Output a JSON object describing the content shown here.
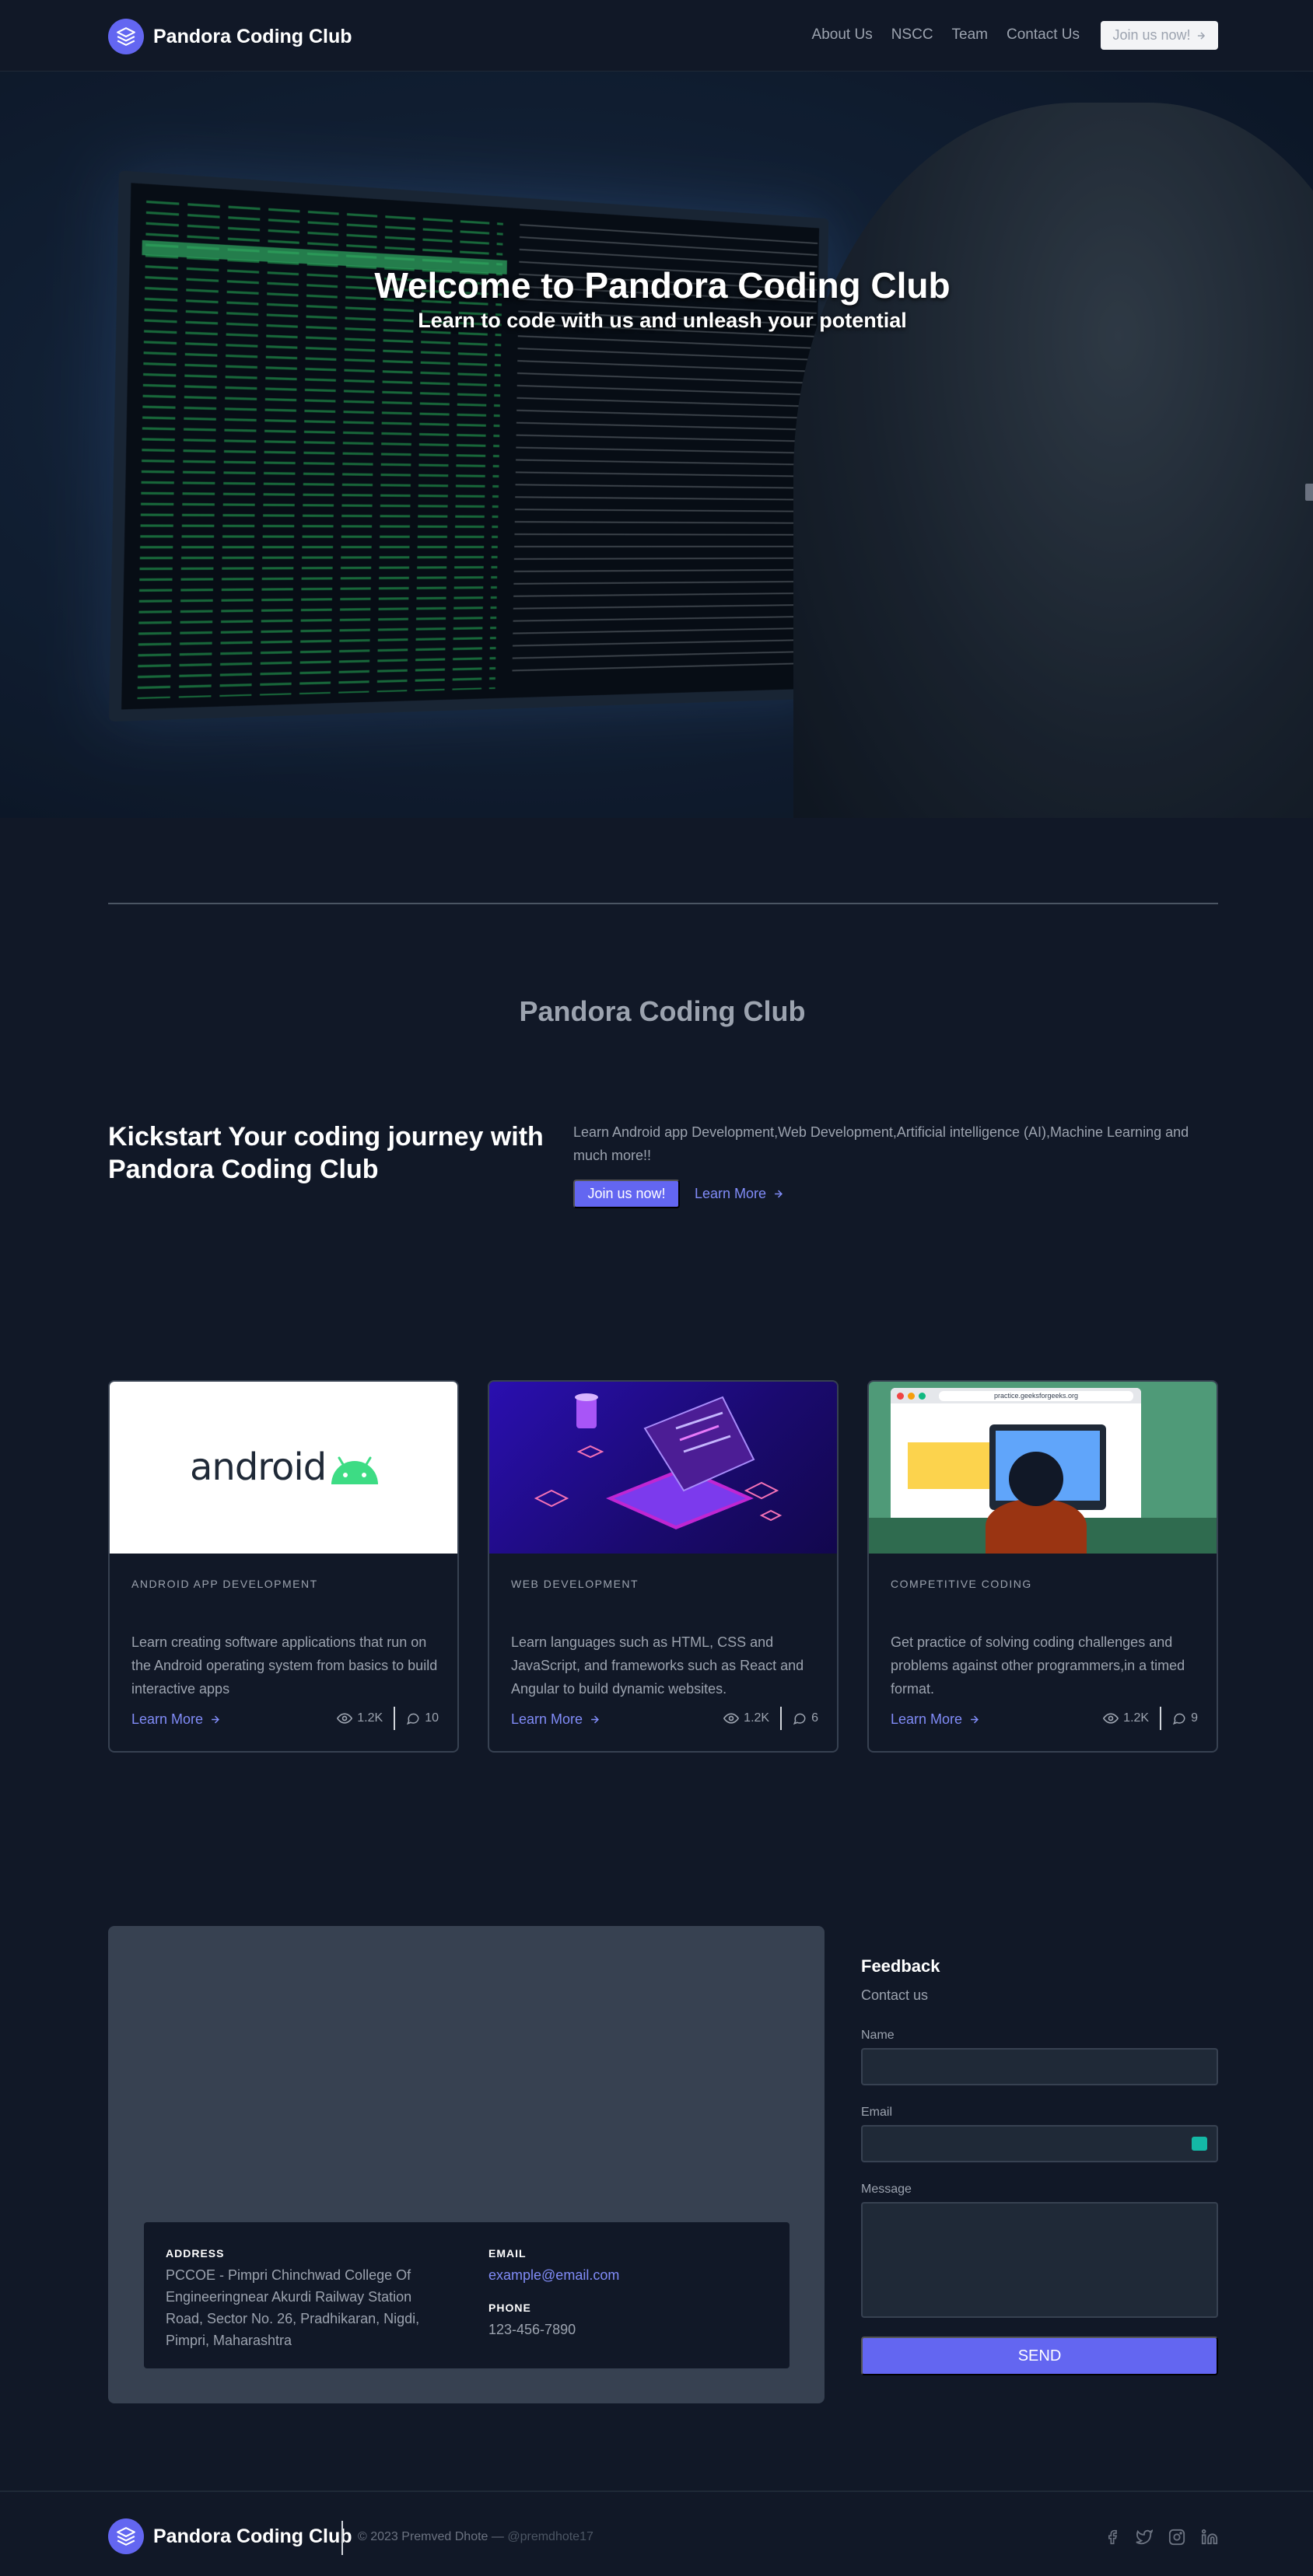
{
  "header": {
    "brand": "Pandora Coding Club",
    "nav": [
      "About Us",
      "NSCC",
      "Team",
      "Contact Us"
    ],
    "join_button": "Join us now!"
  },
  "hero": {
    "title": "Welcome to Pandora Coding Club",
    "subtitle": "Learn to code with us and unleash your potential"
  },
  "intro": {
    "heading": "Pandora Coding Club",
    "title": "Kickstart Your coding journey with Pandora Coding Club",
    "description": "Learn Android app Development,Web Development,Artificial intelligence (AI),Machine Learning and much more!!",
    "join_button": "Join us now!",
    "learn_more": "Learn More"
  },
  "cards": [
    {
      "category": "ANDROID APP DEVELOPMENT",
      "image_text": "android",
      "description": "Learn creating software applications that run on the Android operating system from basics to build interactive apps",
      "learn_more": "Learn More",
      "views": "1.2K",
      "comments": "10"
    },
    {
      "category": "WEB DEVELOPMENT",
      "description": "Learn languages such as HTML, CSS and JavaScript, and frameworks such as React and Angular to build dynamic websites.",
      "learn_more": "Learn More",
      "views": "1.2K",
      "comments": "6"
    },
    {
      "category": "COMPETITIVE CODING",
      "image_text": "practice.geeksforgeeks.org",
      "description": "Get practice of solving coding challenges and problems against other programmers,in a timed format.",
      "learn_more": "Learn More",
      "views": "1.2K",
      "comments": "9"
    }
  ],
  "contact": {
    "address_label": "ADDRESS",
    "address": "PCCOE - Pimpri Chinchwad College Of Engineeringnear Akurdi Railway Station Road, Sector No. 26, Pradhikaran, Nigdi, Pimpri, Maharashtra",
    "email_label": "EMAIL",
    "email": "example@email.com",
    "phone_label": "PHONE",
    "phone": "123-456-7890"
  },
  "feedback": {
    "title": "Feedback",
    "subtitle": "Contact us",
    "name_label": "Name",
    "email_label": "Email",
    "message_label": "Message",
    "send_button": "SEND"
  },
  "footer": {
    "brand": "Pandora Coding Club",
    "copyright": "© 2023 Premved Dhote —",
    "handle": "@premdhote17",
    "social": [
      "facebook-icon",
      "twitter-icon",
      "instagram-icon",
      "linkedin-icon"
    ]
  },
  "colors": {
    "background": "#111827",
    "accent": "#6366f1",
    "link": "#818cf8",
    "text_muted": "#9ca3af"
  }
}
